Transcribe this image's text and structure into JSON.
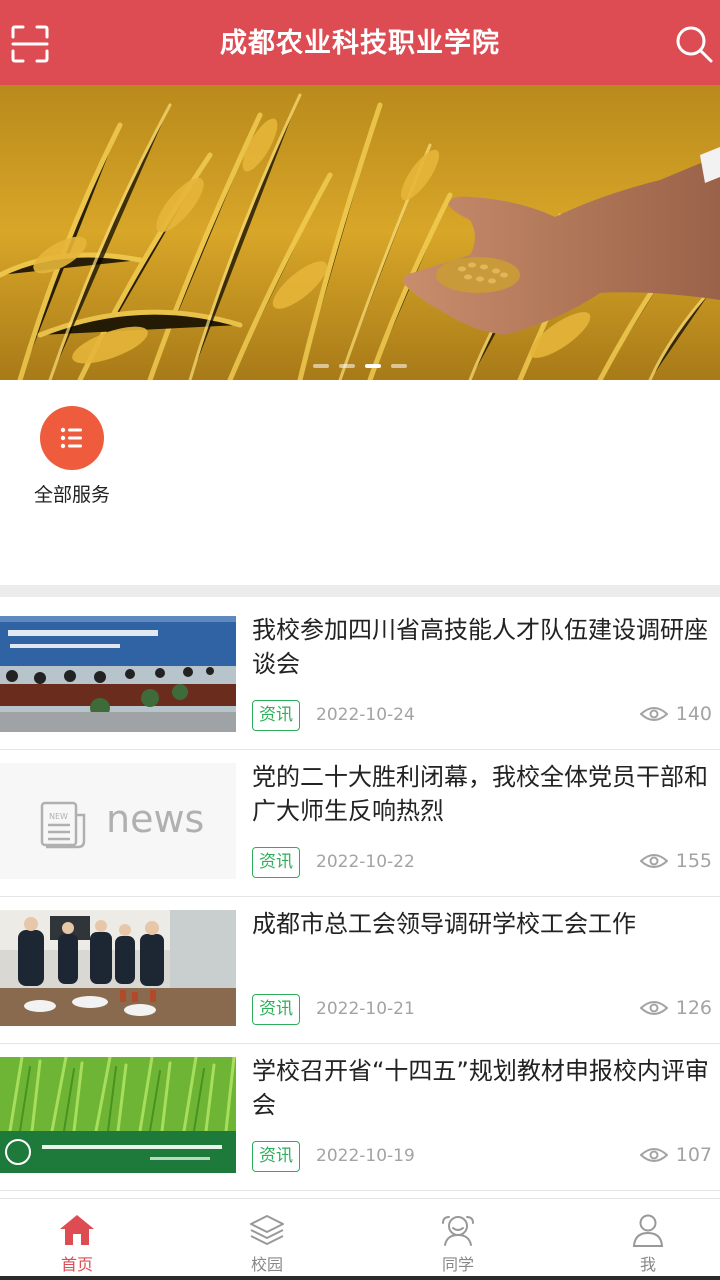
{
  "header": {
    "title": "成都农业科技职业学院",
    "left_icon": "scan-icon",
    "right_icon": "search-icon",
    "color": "#dc4c52"
  },
  "banner": {
    "slide_count": 4,
    "active_slide": 3
  },
  "services": {
    "items": [
      {
        "label": "全部服务",
        "icon": "list-icon",
        "color": "#ef5b3d"
      }
    ]
  },
  "news": {
    "items": [
      {
        "title": "我校参加四川省高技能人才队伍建设调研座谈会",
        "tag": "资讯",
        "date": "2022-10-24",
        "views": "140",
        "thumb": "meeting-photo"
      },
      {
        "title": "党的二十大胜利闭幕，我校全体党员干部和广大师生反响热烈",
        "tag": "资讯",
        "date": "2022-10-22",
        "views": "155",
        "thumb": "news-placeholder",
        "thumb_text": "news"
      },
      {
        "title": "成都市总工会领导调研学校工会工作",
        "tag": "资讯",
        "date": "2022-10-21",
        "views": "126",
        "thumb": "visit-photo"
      },
      {
        "title": "学校召开省“十四五”规划教材申报校内评审会",
        "tag": "资讯",
        "date": "2022-10-19",
        "views": "107",
        "thumb": "wheat-field-photo"
      }
    ]
  },
  "tabbar": {
    "active": 0,
    "tabs": [
      {
        "label": "首页",
        "icon": "home-icon"
      },
      {
        "label": "校园",
        "icon": "layers-icon"
      },
      {
        "label": "同学",
        "icon": "classmates-icon"
      },
      {
        "label": "我",
        "icon": "user-icon"
      }
    ],
    "active_color": "#dc4c52"
  }
}
